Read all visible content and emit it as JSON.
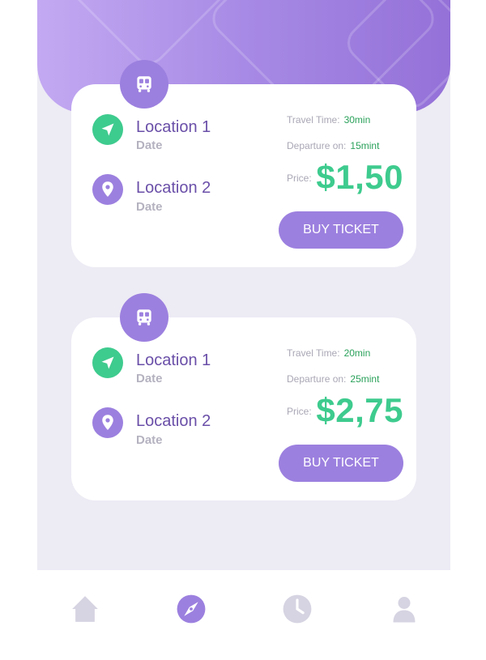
{
  "trips": [
    {
      "from": {
        "name": "Location 1",
        "date": "Date"
      },
      "to": {
        "name": "Location 2",
        "date": "Date"
      },
      "travel_time_label": "Travel Time:",
      "travel_time_value": "30min",
      "departure_label": "Departure on:",
      "departure_value": "15mint",
      "price_label": "Price:",
      "price": "$1,50",
      "buy_label": "BUY TICKET"
    },
    {
      "from": {
        "name": "Location 1",
        "date": "Date"
      },
      "to": {
        "name": "Location 2",
        "date": "Date"
      },
      "travel_time_label": "Travel Time:",
      "travel_time_value": "20min",
      "departure_label": "Departure on:",
      "departure_value": "25mint",
      "price_label": "Price:",
      "price": "$2,75",
      "buy_label": "BUY TICKET"
    }
  ],
  "tabbar": {
    "items": [
      {
        "icon": "home-icon",
        "active": false
      },
      {
        "icon": "compass-icon",
        "active": true
      },
      {
        "icon": "clock-icon",
        "active": false
      },
      {
        "icon": "user-icon",
        "active": false
      }
    ]
  },
  "colors": {
    "accent": "#9c80df",
    "price_green": "#3ecb8e",
    "location_text": "#6a4fa8",
    "tab_inactive": "#d6d3e2",
    "background": "#edebf4"
  }
}
